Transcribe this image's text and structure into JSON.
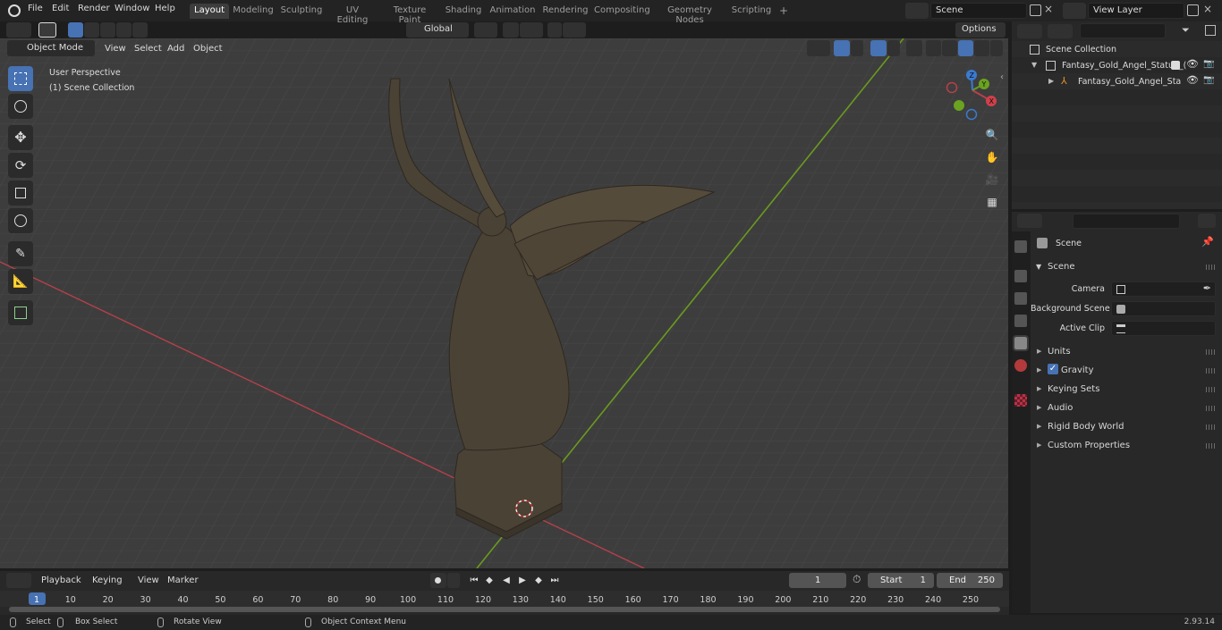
{
  "topbar": {
    "menus": [
      "File",
      "Edit",
      "Render",
      "Window",
      "Help"
    ],
    "workspaces": [
      "Layout",
      "Modeling",
      "Sculpting",
      "UV Editing",
      "Texture Paint",
      "Shading",
      "Animation",
      "Rendering",
      "Compositing",
      "Geometry Nodes",
      "Scripting"
    ],
    "active_workspace": "Layout",
    "add_tab": "+",
    "scene_name": "Scene",
    "view_layer": "View Layer"
  },
  "viewport_header": {
    "mode": "Object Mode",
    "menus": [
      "View",
      "Select",
      "Add",
      "Object"
    ],
    "orientation": "Global",
    "options": "Options"
  },
  "viewport": {
    "perspective_label": "User Perspective",
    "collection_label": "(1) Scene Collection",
    "gizmo_axes": [
      "X",
      "Y",
      "Z"
    ]
  },
  "outliner": {
    "root": "Scene Collection",
    "items": [
      {
        "label": "Fantasy_Gold_Angel_Statue_(",
        "depth": 1
      },
      {
        "label": "Fantasy_Gold_Angel_Sta",
        "depth": 2
      }
    ]
  },
  "properties": {
    "context_label": "Scene",
    "panel_title": "Scene",
    "fields": [
      {
        "label": "Camera"
      },
      {
        "label": "Background Scene"
      },
      {
        "label": "Active Clip"
      }
    ],
    "sections": [
      "Units",
      "Gravity",
      "Keying Sets",
      "Audio",
      "Rigid Body World",
      "Custom Properties"
    ],
    "gravity_checked": true
  },
  "timeline": {
    "menus": [
      "Playback",
      "Keying",
      "View",
      "Marker"
    ],
    "current_frame": "1",
    "start_label": "Start",
    "start_value": "1",
    "end_label": "End",
    "end_value": "250",
    "ticks": [
      "1",
      "10",
      "20",
      "30",
      "40",
      "50",
      "60",
      "70",
      "80",
      "90",
      "100",
      "110",
      "120",
      "130",
      "140",
      "150",
      "160",
      "170",
      "180",
      "190",
      "200",
      "210",
      "220",
      "230",
      "240",
      "250"
    ]
  },
  "statusbar": {
    "select": "Select",
    "box_select": "Box Select",
    "rotate_view": "Rotate View",
    "context_menu": "Object Context Menu",
    "version": "2.93.14"
  },
  "colors": {
    "accent": "#4772b3",
    "x_axis": "#b8404a",
    "y_axis": "#6a9a1f",
    "grid": "#4a4a4a",
    "statue": "#4a4234"
  }
}
